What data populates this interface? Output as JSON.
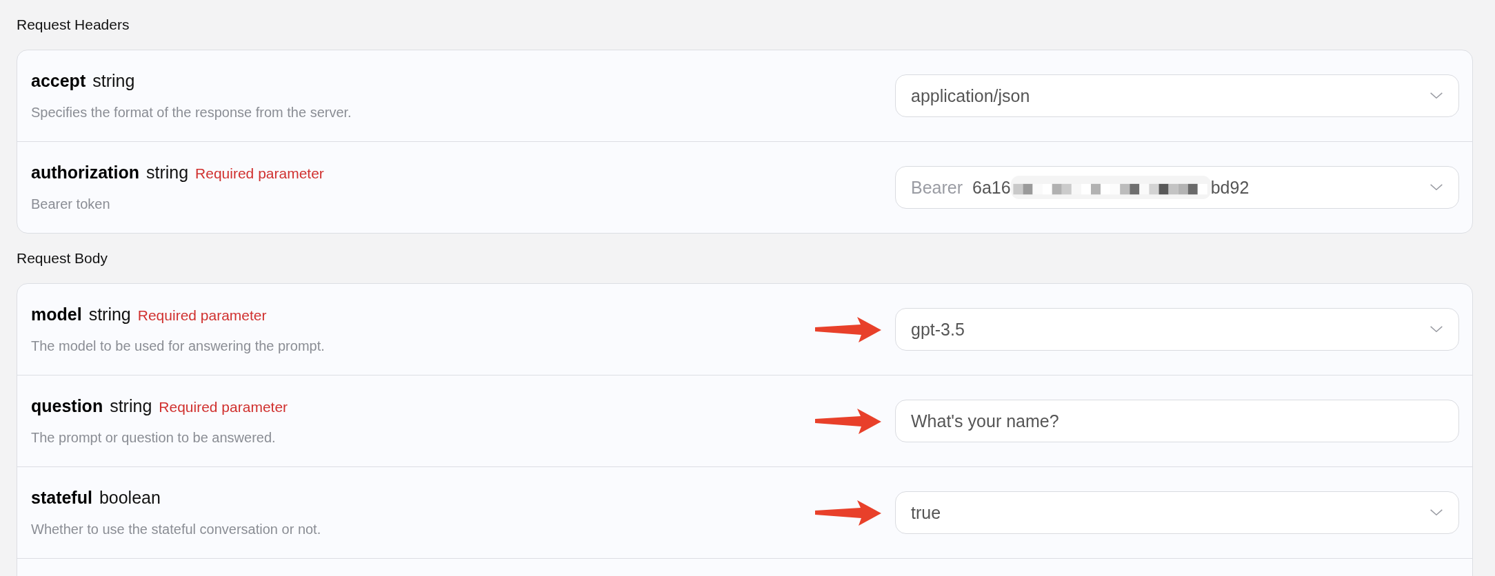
{
  "sections": [
    {
      "title": "Request Headers",
      "params": [
        {
          "name": "accept",
          "type": "string",
          "description": "Specifies the format of the response from the server.",
          "input": {
            "kind": "select",
            "value": "application/json"
          }
        },
        {
          "name": "authorization",
          "type": "string",
          "required_label": "Required parameter",
          "description": "Bearer token",
          "input": {
            "kind": "token",
            "prefix": "Bearer",
            "value_start": "6a16",
            "value_end": "bd92"
          }
        }
      ]
    },
    {
      "title": "Request Body",
      "params": [
        {
          "name": "model",
          "type": "string",
          "required_label": "Required parameter",
          "description": "The model to be used for answering the prompt.",
          "arrow": true,
          "input": {
            "kind": "select",
            "value": "gpt-3.5"
          }
        },
        {
          "name": "question",
          "type": "string",
          "required_label": "Required parameter",
          "description": "The prompt or question to be answered.",
          "arrow": true,
          "input": {
            "kind": "text",
            "value": "What's your name?"
          }
        },
        {
          "name": "stateful",
          "type": "boolean",
          "description": "Whether to use the stateful conversation or not.",
          "arrow": true,
          "input": {
            "kind": "select",
            "value": "true"
          }
        }
      ]
    }
  ]
}
